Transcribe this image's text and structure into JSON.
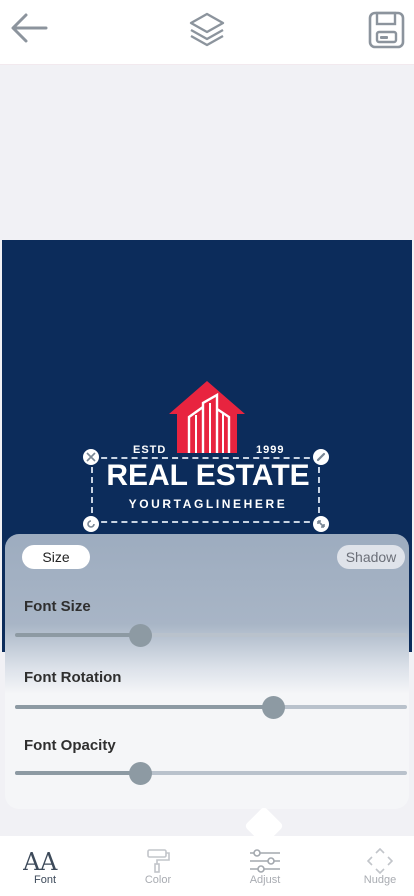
{
  "toolbar": {
    "back_icon": "arrow-left-icon",
    "layers_icon": "layers-icon",
    "save_icon": "floppy-disk-icon"
  },
  "logo": {
    "estd": "ESTD",
    "year": "1999",
    "brand": "REAL ESTATE",
    "tagline": "YOURTAGLINEHERE",
    "brand_color": "#e8243f",
    "background_color": "#0c2c5b"
  },
  "panel": {
    "tabs": [
      {
        "label": "Size",
        "selected": true
      },
      {
        "label": "Shadow",
        "selected": false
      }
    ],
    "sliders": [
      {
        "label": "Font Size",
        "value": 0.32
      },
      {
        "label": "Font Rotation",
        "value": 0.66
      },
      {
        "label": "Font Opacity",
        "value": 0.32
      }
    ]
  },
  "bottom_nav": {
    "items": [
      {
        "label": "Font",
        "icon": "font-aa-icon",
        "active": true
      },
      {
        "label": "Color",
        "icon": "paint-roller-icon",
        "active": false
      },
      {
        "label": "Adjust",
        "icon": "sliders-icon",
        "active": false
      },
      {
        "label": "Nudge",
        "icon": "move-arrows-icon",
        "active": false
      }
    ]
  }
}
